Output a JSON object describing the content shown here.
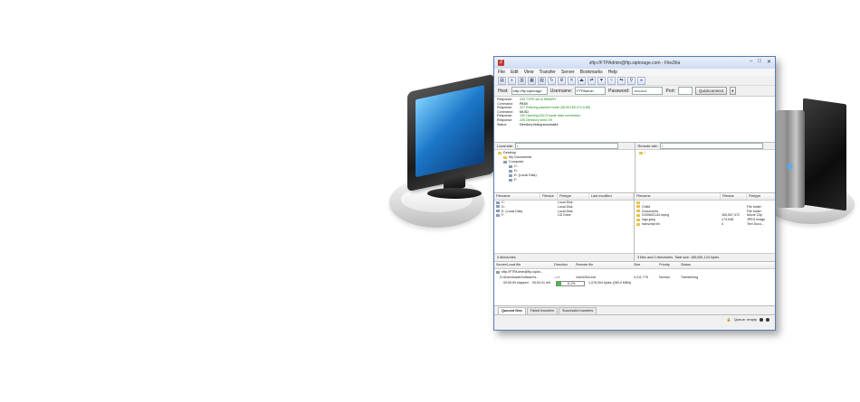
{
  "window": {
    "title": "sftp://FTPAdmin@ftp.siptorage.com - FileZilla",
    "app_icon": "filezilla-icon",
    "minimize": "–",
    "maximize": "□",
    "close": "✕"
  },
  "menu": [
    "File",
    "Edit",
    "View",
    "Transfer",
    "Server",
    "Bookmarks",
    "Help"
  ],
  "quickconnect": {
    "host_label": "Host:",
    "host_value": "sftp://ftp.siptorage",
    "username_label": "Username:",
    "username_value": "FTPAdmin",
    "password_label": "Password:",
    "password_value": "••••••••••",
    "port_label": "Port:",
    "port_value": "",
    "button": "Quickconnect"
  },
  "log": [
    {
      "label": "Response:",
      "msg": "200 TYPE set to BINARY",
      "color": "green"
    },
    {
      "label": "Command:",
      "msg": "PASV",
      "color": "black"
    },
    {
      "label": "Response:",
      "msg": "227 Entering passive mode (38,95,155,274,0,85)",
      "color": "green"
    },
    {
      "label": "Command:",
      "msg": "MLSD",
      "color": "black"
    },
    {
      "label": "Response:",
      "msg": "150 Opening ASCII mode data connection",
      "color": "green"
    },
    {
      "label": "Response:",
      "msg": "226 Directory send OK",
      "color": "green"
    },
    {
      "label": "Status:",
      "msg": "Directory listing successful",
      "color": "black"
    }
  ],
  "local": {
    "site_label": "Local site:",
    "site_value": "\\",
    "tree": [
      {
        "indent": 0,
        "icon": "folder",
        "label": "Desktop"
      },
      {
        "indent": 1,
        "icon": "folder",
        "label": "My Documents"
      },
      {
        "indent": 1,
        "icon": "drive",
        "label": "Computer"
      },
      {
        "indent": 2,
        "icon": "drive",
        "label": "C:"
      },
      {
        "indent": 2,
        "icon": "drive",
        "label": "D:"
      },
      {
        "indent": 2,
        "icon": "drive",
        "label": "E: (Local Disk)"
      },
      {
        "indent": 2,
        "icon": "drive",
        "label": "F:"
      }
    ],
    "headers": [
      "Filename",
      "Filesize",
      "Filetype",
      "Last modified"
    ],
    "rows": [
      [
        "C:",
        "",
        "Local Disk",
        ""
      ],
      [
        "D:",
        "",
        "Local Disk",
        ""
      ],
      [
        "E: (Local Disk)",
        "",
        "Local Disk",
        ""
      ],
      [
        "F:",
        "",
        "CD Drive",
        ""
      ]
    ],
    "status": "4 directories"
  },
  "remote": {
    "site_label": "Remote site:",
    "site_value": "/",
    "tree": [
      {
        "indent": 0,
        "icon": "folder",
        "label": "/"
      }
    ],
    "headers": [
      "Filename",
      "Filesize",
      "Filetype"
    ],
    "rows": [
      [
        "..",
        "",
        ""
      ],
      [
        "Chilfd",
        "",
        "File folder"
      ],
      [
        "Documents",
        "",
        "File folder"
      ],
      [
        "0100602143.mpeg",
        "165,507,372",
        "Movie Clip"
      ],
      [
        "logo.jpeg",
        "174,048",
        "JPEG image"
      ],
      [
        "transcript.txt",
        "4",
        "Text Docu..."
      ]
    ],
    "status": "3 files and 2 directories. Total size: 165,681,124 bytes"
  },
  "queue": {
    "headers": [
      "Server/Local file",
      "Direction",
      "Remote file",
      "Size",
      "Priority",
      "Status"
    ],
    "server_row": "sftp://FTPAdmin@ftp.siptor...",
    "file_row": {
      "local": "D:\\Downloads\\Software\\z...",
      "direction": "-->>",
      "remote": "/var/42full.exe",
      "size": "9,211,776",
      "priority": "Normal",
      "status": "Transferring"
    },
    "progress_row": {
      "elapsed": "00:00:09 elapsed",
      "left": "00:00:41 left",
      "percent_label": "11.2%",
      "percent": 11.2,
      "bytes": "1,076,904 bytes (280.0 KiB/s)"
    }
  },
  "tabs": [
    "Queued files",
    "Failed transfers",
    "Successful transfers"
  ],
  "statusbar": {
    "queue": "Queue: empty"
  },
  "colors": {
    "accent": "#5a7bb8",
    "progress": "#3fbf3f",
    "log_green": "#1a8a1a"
  }
}
